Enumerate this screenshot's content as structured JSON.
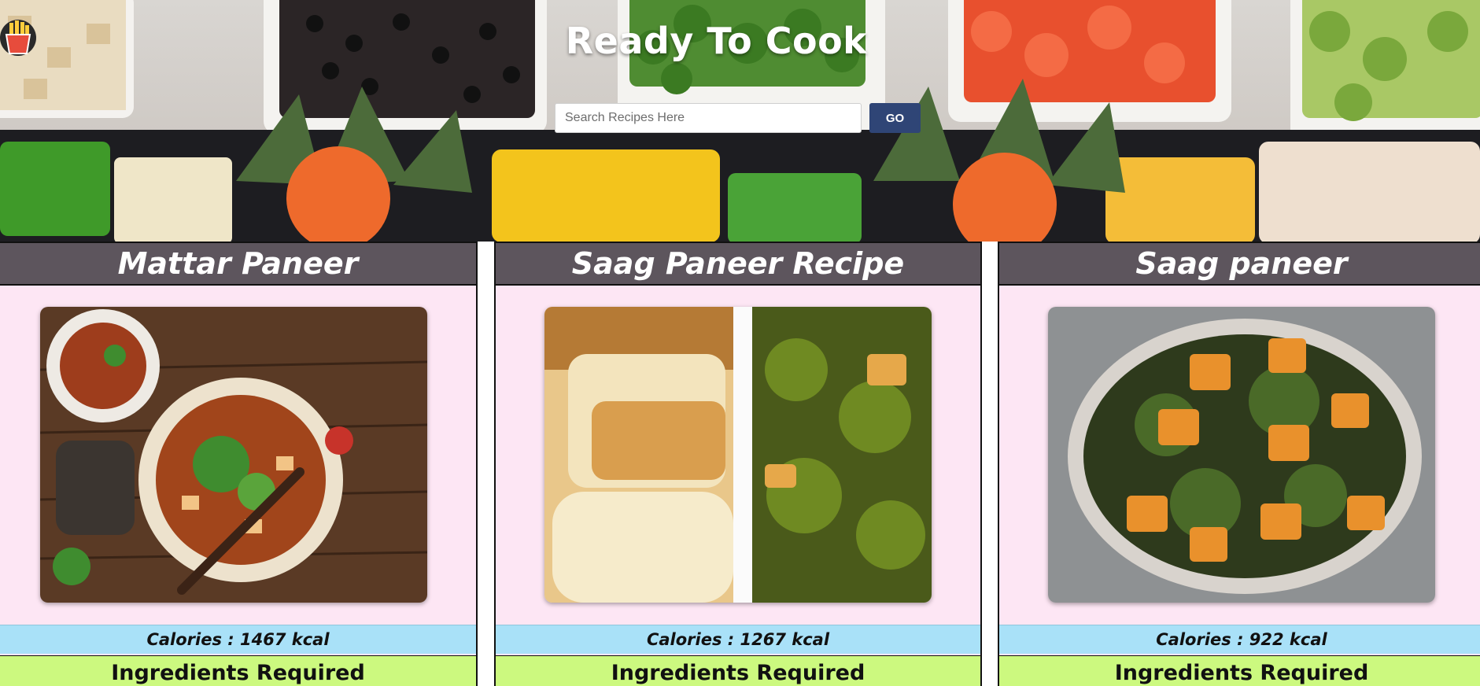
{
  "hero": {
    "title": "Ready To Cook",
    "title_icon": "french-fries-icon",
    "search": {
      "placeholder": "Search Recipes Here",
      "value": "",
      "button_label": "GO"
    }
  },
  "recipes": [
    {
      "title": "Mattar Paneer",
      "calories": "Calories : 1467 kcal",
      "ingredients_heading": "Ingredients Required",
      "image_label": "mattar-paneer-photo"
    },
    {
      "title": "Saag Paneer Recipe",
      "calories": "Calories : 1267 kcal",
      "ingredients_heading": "Ingredients Required",
      "image_label": "saag-paneer-recipe-photo"
    },
    {
      "title": "Saag paneer",
      "calories": "Calories : 922 kcal",
      "ingredients_heading": "Ingredients Required",
      "image_label": "saag-paneer-photo"
    }
  ],
  "colors": {
    "card_header": "#5d555d",
    "card_body": "#fde6f4",
    "calories_band": "#a9e1f8",
    "ingredients_band": "#ccf97f",
    "go_button": "#2f4576"
  }
}
